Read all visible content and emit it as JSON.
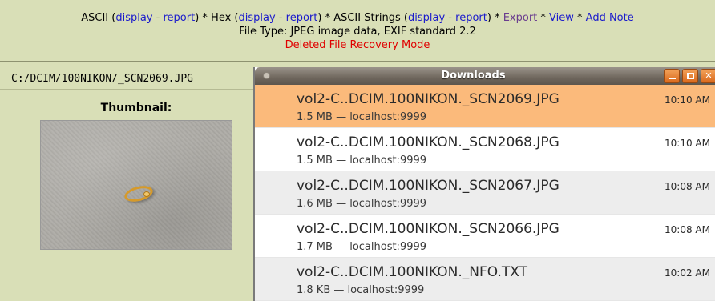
{
  "toolbar": {
    "ascii_label": "ASCII (",
    "ascii_display": "display",
    "sep1": " - ",
    "ascii_report": "report",
    "hex_label": ") * Hex (",
    "hex_display": "display",
    "sep2": " - ",
    "hex_report": "report",
    "strings_label": ") * ASCII Strings (",
    "strings_display": "display",
    "sep3": " - ",
    "strings_report": "report",
    "after_strings": ") * ",
    "export": "Export",
    "star1": " * ",
    "view": "View",
    "star2": " * ",
    "add_note": "Add Note",
    "file_type": "File Type: JPEG image data, EXIF standard 2.2",
    "mode": "Deleted File Recovery Mode"
  },
  "left": {
    "path": "C:/DCIM/100NIKON/_SCN2069.JPG",
    "thumbnail_label": "Thumbnail:"
  },
  "downloads": {
    "title": "Downloads",
    "items": [
      {
        "name": "vol2-C..DCIM.100NIKON._SCN2069.JPG",
        "meta": "1.5 MB — localhost:9999",
        "time": "10:10 AM"
      },
      {
        "name": "vol2-C..DCIM.100NIKON._SCN2068.JPG",
        "meta": "1.5 MB — localhost:9999",
        "time": "10:10 AM"
      },
      {
        "name": "vol2-C..DCIM.100NIKON._SCN2067.JPG",
        "meta": "1.6 MB — localhost:9999",
        "time": "10:08 AM"
      },
      {
        "name": "vol2-C..DCIM.100NIKON._SCN2066.JPG",
        "meta": "1.7 MB — localhost:9999",
        "time": "10:08 AM"
      },
      {
        "name": "vol2-C..DCIM.100NIKON._NFO.TXT",
        "meta": "1.8 KB — localhost:9999",
        "time": "10:02 AM"
      }
    ]
  },
  "colors": {
    "background": "#d9dfb7",
    "link": "#1a1acc",
    "mode": "#e00000",
    "selected_row": "#fbba7b",
    "window_button": "#e07a2e"
  },
  "icons": [
    "minimize-icon",
    "maximize-icon",
    "close-icon",
    "window-menu-icon"
  ]
}
